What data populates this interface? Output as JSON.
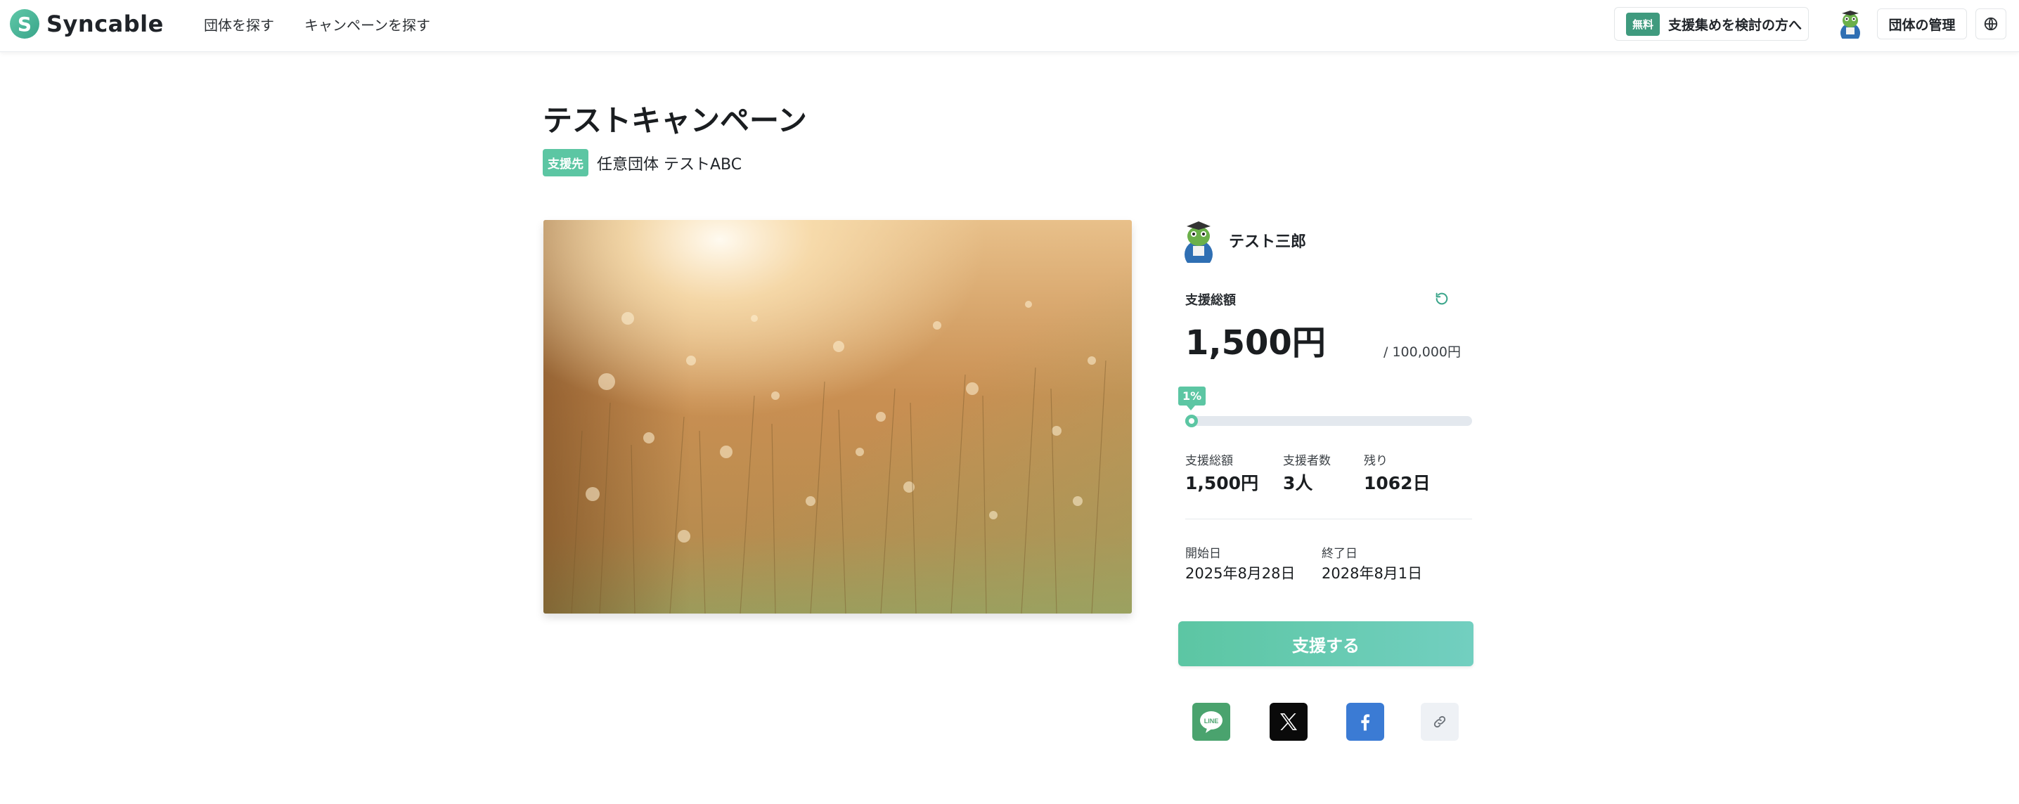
{
  "header": {
    "logo_text": "Syncable",
    "nav": [
      "団体を探す",
      "キャンペーンを探す"
    ],
    "cta_badge": "無料",
    "cta_text": "支援集めを検討の方へ",
    "org_manage": "団体の管理"
  },
  "campaign": {
    "title": "テストキャンペーン",
    "recipient_badge": "支援先",
    "recipient_name": "任意団体 テストABC"
  },
  "panel": {
    "creator_name": "テスト三郎",
    "total_label": "支援総額",
    "total_amount": "1,500円",
    "goal": "/ 100,000円",
    "progress_label": "1%",
    "progress_fraction": 0.015,
    "stats": [
      {
        "label": "支援総額",
        "value": "1,500円"
      },
      {
        "label": "支援者数",
        "value": "3人"
      },
      {
        "label": "残り",
        "value": "1062日"
      }
    ],
    "dates": [
      {
        "label": "開始日",
        "value": "2025年8月28日"
      },
      {
        "label": "終了日",
        "value": "2028年8月1日"
      }
    ],
    "support_button": "支援する"
  },
  "icons": {
    "logo": "syncable-logo-icon",
    "globe": "globe-icon",
    "refresh": "refresh-icon",
    "share": [
      "line-icon",
      "x-icon",
      "facebook-icon",
      "link-icon"
    ]
  },
  "colors": {
    "accent": "#5cc6a3",
    "free_badge": "#3f9a7e",
    "line": "#4aa36e",
    "x": "#0a0a0a",
    "facebook": "#3b7bd4"
  }
}
